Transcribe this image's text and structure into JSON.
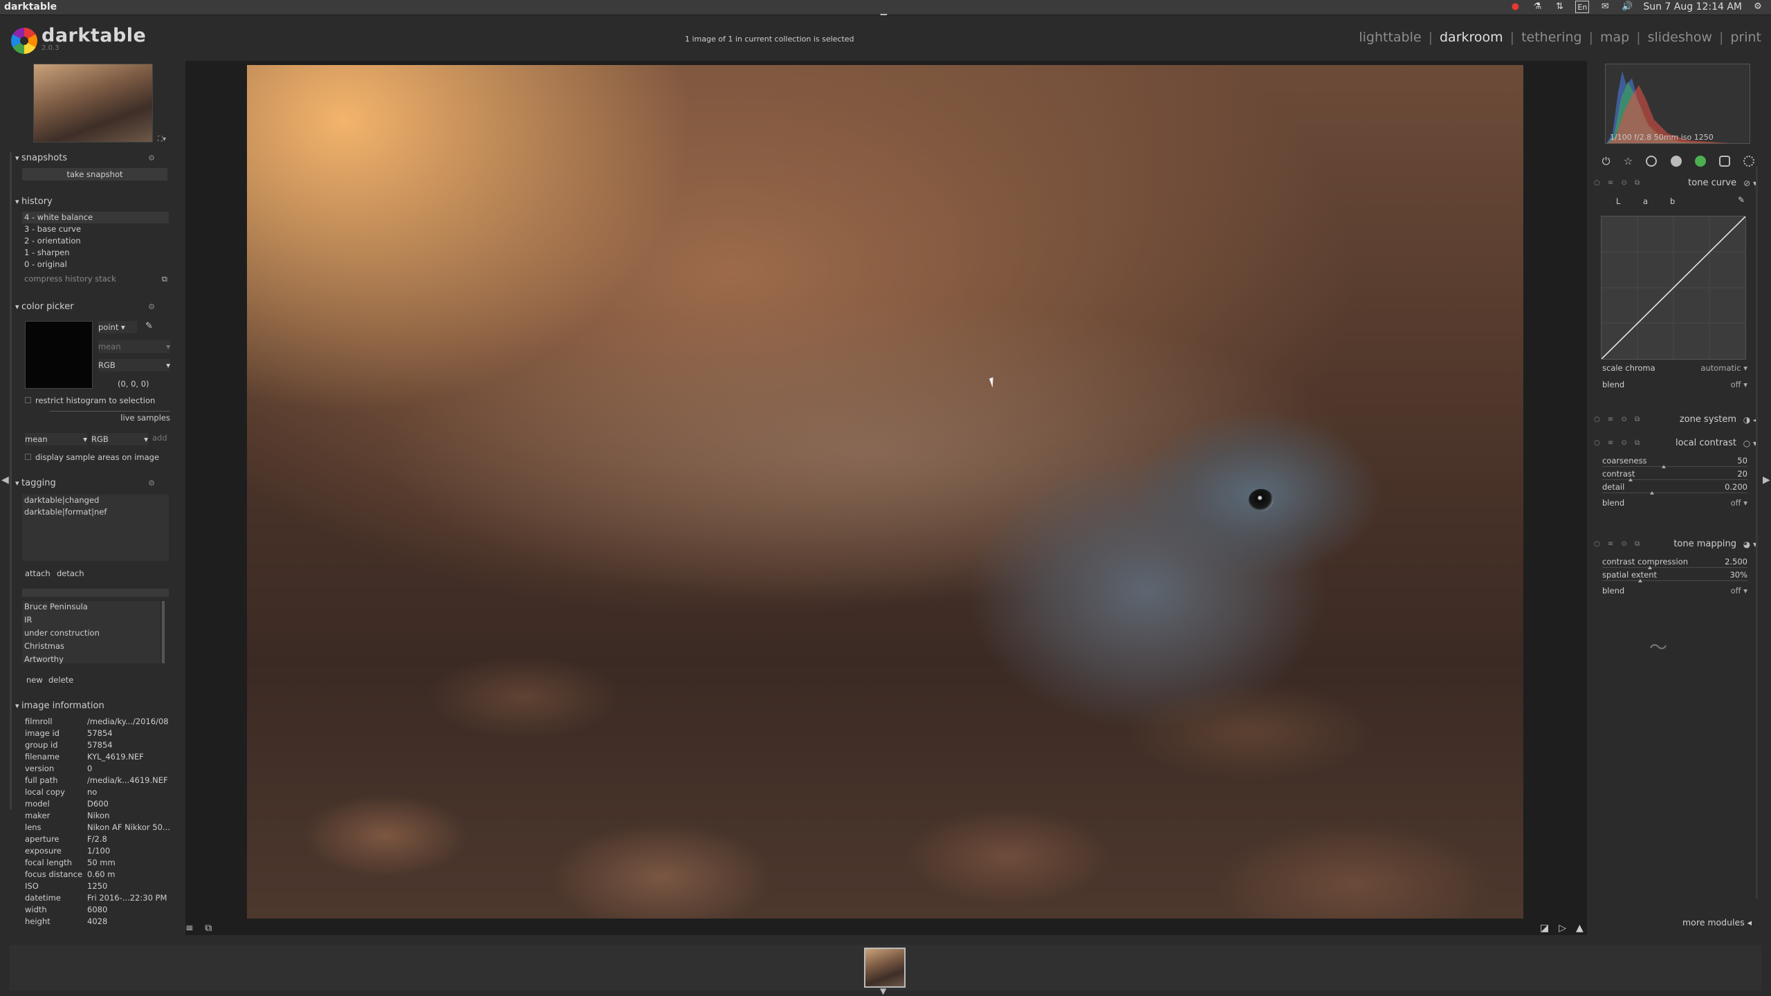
{
  "window_title": "darktable",
  "tray": {
    "input_method": "En",
    "datetime": "Sun 7 Aug 12:14 AM"
  },
  "app": {
    "name": "darktable",
    "version": "2.0.3"
  },
  "collection_status": "1 image of 1 in current collection is selected",
  "views": [
    "lighttable",
    "darkroom",
    "tethering",
    "map",
    "slideshow",
    "print"
  ],
  "active_view": "darkroom",
  "left_panel": {
    "snapshots": {
      "title": "snapshots",
      "take_snapshot": "take snapshot"
    },
    "history": {
      "title": "history",
      "items": [
        "4 - white balance",
        "3 - base curve",
        "2 - orientation",
        "1 - sharpen",
        "0 - original"
      ],
      "compress": "compress history stack"
    },
    "color_picker": {
      "title": "color picker",
      "mode": "point",
      "stat": "mean",
      "model": "RGB",
      "value": "(0, 0, 0)",
      "restrict": "restrict histogram to selection",
      "live_samples": "live samples",
      "live_stat": "mean",
      "live_model": "RGB",
      "add": "add",
      "display_samples": "display sample areas on image"
    },
    "tagging": {
      "title": "tagging",
      "attached": [
        "darktable|changed",
        "darktable|format|nef"
      ],
      "attach": "attach",
      "detach": "detach",
      "dictionary": [
        "Bruce Peninsula",
        "IR",
        "under construction",
        "Christmas",
        "Artworthy"
      ],
      "new": "new",
      "delete": "delete"
    },
    "image_information": {
      "title": "image information",
      "rows": [
        {
          "k": "filmroll",
          "v": "/media/ky.../2016/08"
        },
        {
          "k": "image id",
          "v": "57854"
        },
        {
          "k": "group id",
          "v": "57854"
        },
        {
          "k": "filename",
          "v": "KYL_4619.NEF"
        },
        {
          "k": "version",
          "v": "0"
        },
        {
          "k": "full path",
          "v": "/media/k...4619.NEF"
        },
        {
          "k": "local copy",
          "v": "no"
        },
        {
          "k": "model",
          "v": "D600"
        },
        {
          "k": "maker",
          "v": "Nikon"
        },
        {
          "k": "lens",
          "v": "Nikon AF Nikkor 50..."
        },
        {
          "k": "aperture",
          "v": "F/2.8"
        },
        {
          "k": "exposure",
          "v": "1/100"
        },
        {
          "k": "focal length",
          "v": "50 mm"
        },
        {
          "k": "focus distance",
          "v": "0.60 m"
        },
        {
          "k": "ISO",
          "v": "1250"
        },
        {
          "k": "datetime",
          "v": "Fri 2016-...22:30 PM"
        },
        {
          "k": "width",
          "v": "6080"
        },
        {
          "k": "height",
          "v": "4028"
        }
      ]
    }
  },
  "right_panel": {
    "histogram_info": "1/100 f/2.8 50mm iso 1250",
    "tone_curve": {
      "title": "tone curve",
      "tabs": [
        "L",
        "a",
        "b"
      ],
      "scale_chroma_label": "scale chroma",
      "scale_chroma_value": "automatic",
      "blend_label": "blend",
      "blend_value": "off"
    },
    "zone_system": {
      "title": "zone system"
    },
    "local_contrast": {
      "title": "local contrast",
      "sliders": [
        {
          "label": "coarseness",
          "value": "50",
          "frac": 0.5
        },
        {
          "label": "contrast",
          "value": "20",
          "frac": 0.2
        },
        {
          "label": "detail",
          "value": "0.200",
          "frac": 0.4
        }
      ],
      "blend_label": "blend",
      "blend_value": "off"
    },
    "tone_mapping": {
      "title": "tone mapping",
      "sliders": [
        {
          "label": "contrast compression",
          "value": "2.500",
          "frac": 0.38
        },
        {
          "label": "spatial extent",
          "value": "30%",
          "frac": 0.3
        }
      ],
      "blend_label": "blend",
      "blend_value": "off"
    },
    "more_modules": "more modules"
  }
}
